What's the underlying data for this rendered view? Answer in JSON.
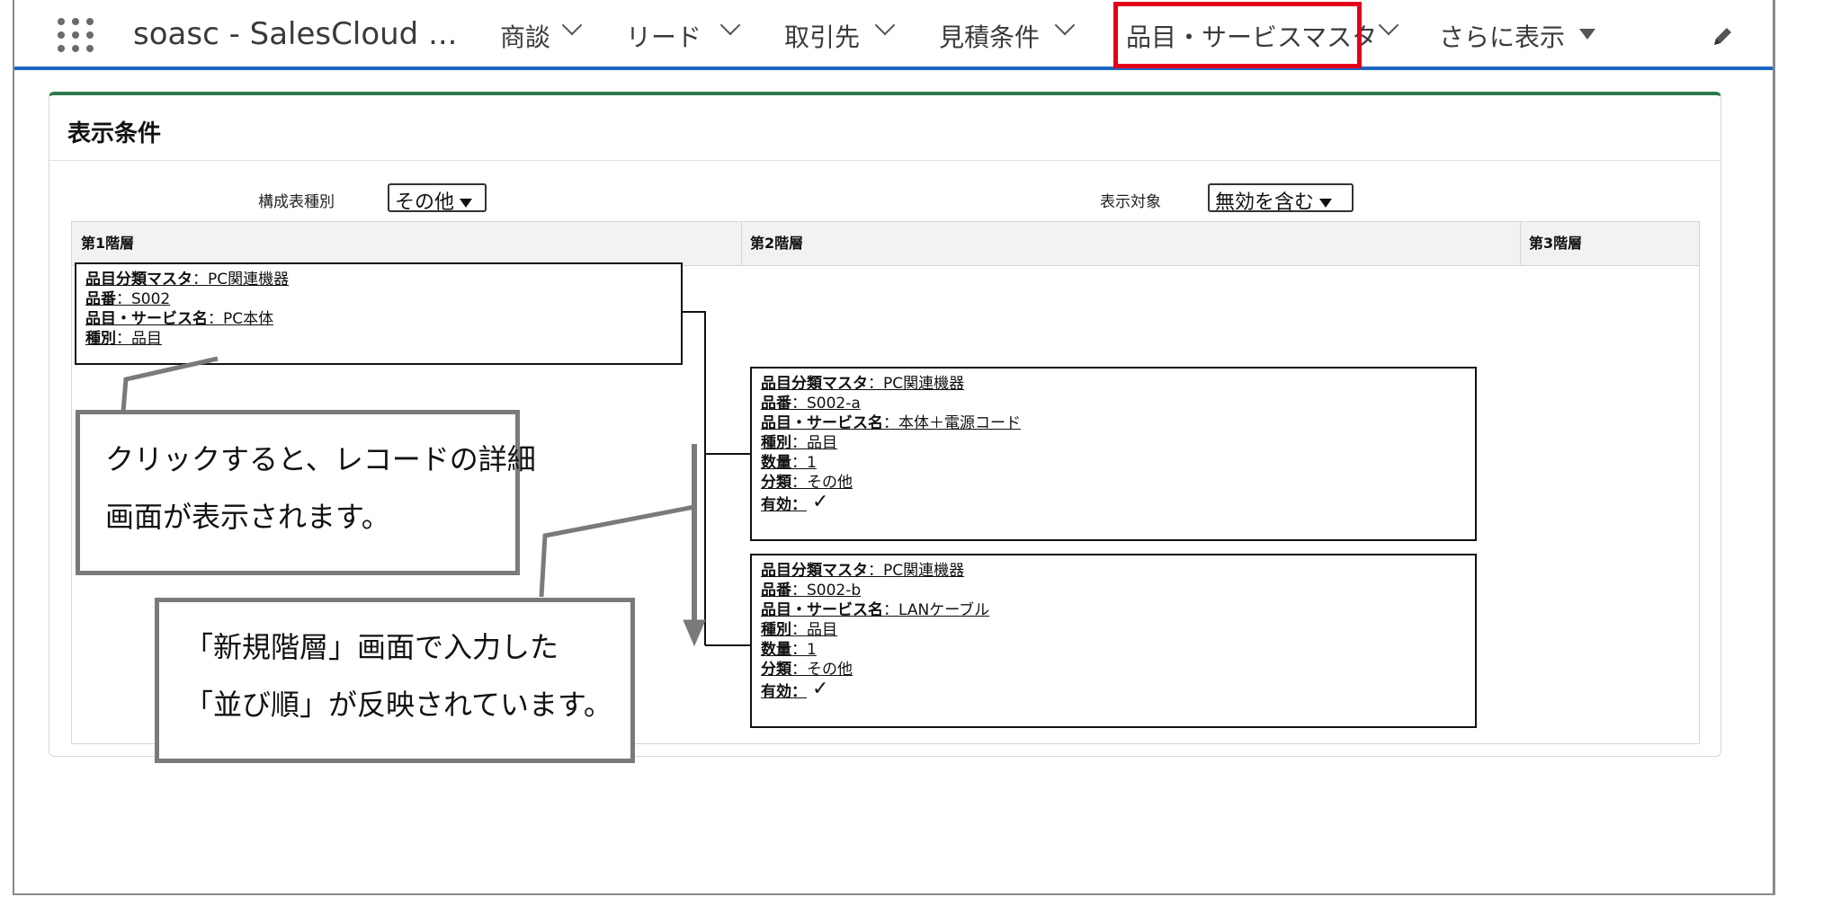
{
  "nav": {
    "app_name": "soasc - SalesCloud ...",
    "items": [
      {
        "label": "商談"
      },
      {
        "label": "リード"
      },
      {
        "label": "取引先"
      },
      {
        "label": "見積条件"
      },
      {
        "label": "品目・サービスマスタ"
      },
      {
        "label": "さらに表示"
      }
    ],
    "highlight_color": "#e3001b",
    "accent_color": "#1b67c2"
  },
  "panel": {
    "title": "表示条件",
    "filters": {
      "type_label": "構成表種別",
      "type_value": "その他",
      "target_label": "表示対象",
      "target_value": "無効を含む"
    },
    "columns": [
      "第1階層",
      "第2階層",
      "第3階層"
    ]
  },
  "records": {
    "level1": {
      "category_key": "品目分類マスタ",
      "category_value": "：PC関連機器",
      "number_key": "品番",
      "number_value": "：S002",
      "name_key": "品目・サービス名",
      "name_value": "：PC本体",
      "kind_key": "種別",
      "kind_value": "：品目"
    },
    "level2": [
      {
        "category_key": "品目分類マスタ",
        "category_value": "：PC関連機器",
        "number_key": "品番",
        "number_value": "：S002-a",
        "name_key": "品目・サービス名",
        "name_value": "：本体＋電源コード",
        "kind_key": "種別",
        "kind_value": "：品目",
        "qty_key": "数量",
        "qty_value": "：1",
        "class_key": "分類",
        "class_value": "：その他",
        "active_key": "有効：",
        "active_mark": "✓"
      },
      {
        "category_key": "品目分類マスタ",
        "category_value": "：PC関連機器",
        "number_key": "品番",
        "number_value": "：S002-b",
        "name_key": "品目・サービス名",
        "name_value": "：LANケーブル",
        "kind_key": "種別",
        "kind_value": "：品目",
        "qty_key": "数量",
        "qty_value": "：1",
        "class_key": "分類",
        "class_value": "：その他",
        "active_key": "有効：",
        "active_mark": "✓"
      }
    ]
  },
  "callouts": {
    "detail": [
      "クリックすると、レコードの詳細",
      "画面が表示されます。"
    ],
    "order": [
      "「新規階層」画面で入力した",
      "「並び順」が反映されています。"
    ]
  }
}
